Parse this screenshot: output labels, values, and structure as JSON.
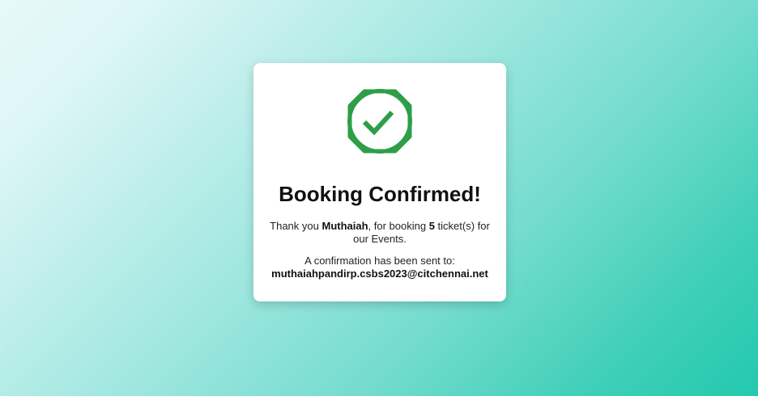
{
  "card": {
    "icon": "check-circle-icon",
    "icon_color": "#2e9e48",
    "title": "Booking Confirmed!",
    "message": {
      "prefix": "Thank you ",
      "name": "Muthaiah",
      "middle": ", for booking ",
      "ticket_count": "5",
      "suffix": " ticket(s) for our Events."
    },
    "confirmation_text": "A confirmation has been sent to:",
    "email": "muthaiahpandirp.csbs2023@citchennai.net"
  }
}
